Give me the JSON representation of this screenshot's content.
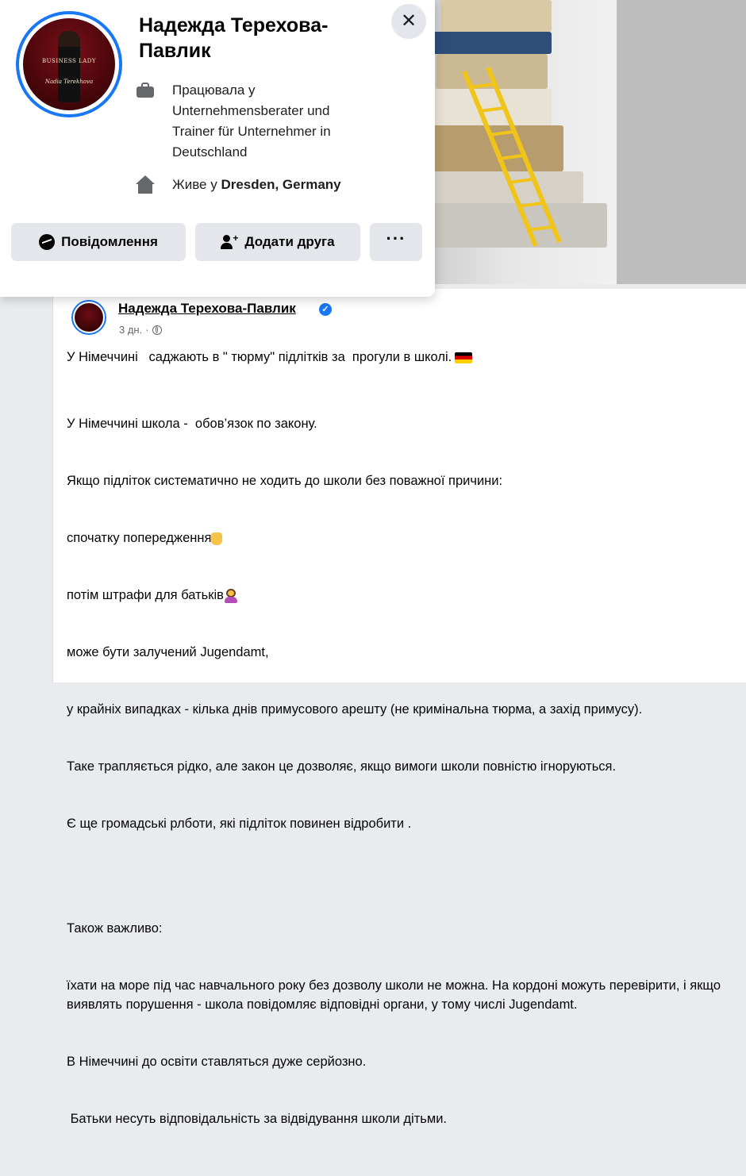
{
  "profile_card": {
    "name": "Надежда Терехова-Павлик",
    "work_text": "Працювала у Unternehmensberater und Trainer für Unternehmer in Deutschland",
    "lives_prefix": "Живе у ",
    "lives_place": "Dresden, Germany",
    "avatar_text_1": "BUSINESS LADY",
    "avatar_text_2": "Nadia Terekhova",
    "close_symbol": "✕",
    "buttons": {
      "message": "Повідомлення",
      "add_friend": "Додати друга",
      "more": "···"
    },
    "icons": {
      "work": "briefcase-icon",
      "lives": "house-icon",
      "message": "messenger-icon",
      "add_friend": "add-friend-icon"
    }
  },
  "post": {
    "author": "Надежда Терехова-Павлик",
    "verified_symbol": "✓",
    "time": "3 дн.",
    "separator": "·",
    "paragraph_1": "У Німеччині   саджають в \" тюрму\" підлітків за  прогули в школі.",
    "paragraph_2": [
      "У Німеччині школа -  обов’язок по закону.",
      "Якщо підліток систематично не ходить до школи без поважної причини:",
      "спочатку попередження",
      "потім штрафи для батьків",
      "може бути залучений Jugendamt,",
      "у крайніх випадках - кілька днів примусового арешту (не кримінальна тюрма, а захід примусу).",
      "Таке трапляється рідко, але закон це дозволяє, якщо вимоги школи повністю ігноруються.",
      "Є ще громадські рлботи, які підліток повинен відробити ."
    ],
    "paragraph_3": [
      "Також важливо:",
      "їхати на море під час навчального року без дозволу школи не можна. На кордоні можуть перевірити, і якщо виявлять порушення - школа повідомляє відповідні органи, у тому числі Jugendamt.",
      "В Німеччині до освіти ставляться дуже серйозно.",
      " Батьки несуть відповідальність за відвідування школи дітьми."
    ]
  }
}
